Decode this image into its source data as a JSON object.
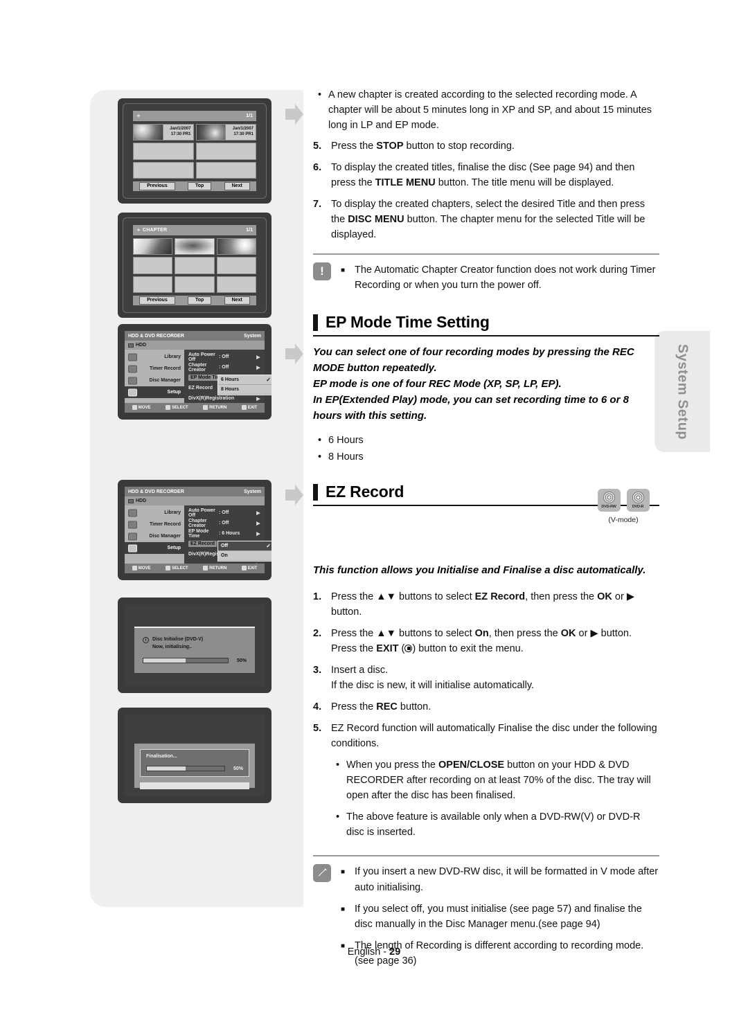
{
  "doc": {
    "footer_lang": "English",
    "footer_sep": " - ",
    "footer_page": "29",
    "side_tab": "System Setup"
  },
  "intro_bullet": "A new chapter is created according to the selected recording mode. A chapter will be about 5 minutes long in XP and SP, and about 15 minutes long in LP and EP mode.",
  "steps_top": [
    {
      "n": "5.",
      "text_html": "Press the <b>STOP</b> button to stop recording."
    },
    {
      "n": "6.",
      "text_html": "To display the created titles, finalise the disc (See page 94) and then press the <b>TITLE MENU</b> button. The title menu will be displayed."
    },
    {
      "n": "7.",
      "text_html": "To display the created chapters, select the desired Title and then press the <b>DISC MENU</b> button. The chapter menu for the selected Title will be displayed."
    }
  ],
  "caution_note": {
    "badge": "!",
    "items": [
      "The Automatic Chapter Creator function does not work during Timer Recording or when you turn the power off."
    ]
  },
  "section_ep": {
    "heading": "EP Mode Time Setting",
    "intro_lines": [
      "You can select one of four recording modes by pressing the REC MODE button repeatedly.",
      "EP mode is one of four REC Mode (XP, SP, LP, EP).",
      "In EP(Extended Play) mode, you can set recording time to 6 or 8 hours with this setting."
    ],
    "options": [
      "6 Hours",
      "8 Hours"
    ]
  },
  "section_ez": {
    "heading": "EZ Record",
    "discs": [
      {
        "label": "DVD-RW"
      },
      {
        "label": "DVD-R"
      }
    ],
    "disc_caption": "(V-mode)",
    "intro": "This function allows you Initialise and Finalise a disc automatically.",
    "steps": [
      {
        "n": "1.",
        "text_html": "Press the ▲▼ buttons to select <b>EZ Record</b>, then press the <b>OK</b> or ▶ button."
      },
      {
        "n": "2.",
        "text_html": "Press the ▲▼ buttons to select <b>On</b>, then press the <b>OK</b> or ▶ button. Press the <b>EXIT</b> (<span class=\"exit-ico\"></span>) button to exit the menu."
      },
      {
        "n": "3.",
        "text_html": "Insert a disc.<br>If the disc is new, it will initialise automatically."
      },
      {
        "n": "4.",
        "text_html": "Press the <b>REC</b> button."
      },
      {
        "n": "5.",
        "text_html": "EZ Record function will automatically Finalise the disc under the following conditions."
      }
    ],
    "sub_bullets": [
      "When you press the <b>OPEN/CLOSE</b> button on your HDD &amp; DVD RECORDER after recording on at least 70% of the disc. The tray will open after the disc has been finalised.",
      "The above feature is available only when a DVD-RW(V) or DVD-R disc is inserted."
    ],
    "note": {
      "badge": "pencil-icon",
      "items": [
        "If you insert a new DVD-RW disc, it will be formatted in V mode after auto initialising.",
        "If you select off, you must initialise (see page 57) and finalise the disc manually in the Disc Manager menu.(see page 94)",
        "The length of Recording is different according to recording mode. (see page 36)"
      ]
    }
  },
  "screens": {
    "title_menu": {
      "header_title": "",
      "page_indicator": "1/1",
      "entries": [
        {
          "date": "Jan/1/2007",
          "time": "17:30 PR1"
        },
        {
          "date": "Jan/1/2007",
          "time": "17:30 PR1"
        }
      ],
      "buttons": [
        "Previous",
        "Top",
        "Next"
      ]
    },
    "chapter_menu": {
      "header_title": "CHAPTER",
      "page_indicator": "1/1",
      "buttons": [
        "Previous",
        "Top",
        "Next"
      ]
    },
    "setup_ep": {
      "title_left": "HDD & DVD RECORDER",
      "title_right": "System",
      "source": "HDD",
      "sidebar": [
        "Library",
        "Timer Record",
        "Disc Manager",
        "Setup"
      ],
      "sidebar_selected": "Setup",
      "rows": [
        {
          "name": "Auto Power Off",
          "value": ": Off",
          "chev": "▶"
        },
        {
          "name": "Chapter Creator",
          "value": ": Off",
          "chev": "▶"
        },
        {
          "name": "EP Mode Time",
          "value": "",
          "chev": ""
        },
        {
          "name": "EZ Record",
          "value": "",
          "chev": ""
        },
        {
          "name": "DivX(R)Registration",
          "value": "",
          "chev": "▶"
        },
        {
          "name": "",
          "value": "",
          "chev": "▶"
        }
      ],
      "highlight_row": "EP Mode Time",
      "popup": {
        "options": [
          {
            "label": "6 Hours",
            "selected": true,
            "check": "✓"
          },
          {
            "label": "8 Hours",
            "selected": false,
            "check": ""
          }
        ]
      },
      "footer": [
        "MOVE",
        "SELECT",
        "RETURN",
        "EXIT"
      ]
    },
    "setup_ez": {
      "title_left": "HDD & DVD RECORDER",
      "title_right": "System",
      "source": "HDD",
      "sidebar": [
        "Library",
        "Timer Record",
        "Disc Manager",
        "Setup"
      ],
      "sidebar_selected": "Setup",
      "rows": [
        {
          "name": "Auto Power Off",
          "value": ": Off",
          "chev": "▶"
        },
        {
          "name": "Chapter Creator",
          "value": ": Off",
          "chev": "▶"
        },
        {
          "name": "EP Mode Time",
          "value": ": 6 Hours",
          "chev": "▶"
        },
        {
          "name": "EZ Record",
          "value": "",
          "chev": ""
        },
        {
          "name": "DivX(R)Registra",
          "value": "",
          "chev": ""
        },
        {
          "name": "",
          "value": "",
          "chev": "▶"
        }
      ],
      "highlight_row": "EZ Record",
      "popup": {
        "options": [
          {
            "label": "Off",
            "selected": true,
            "check": "✓"
          },
          {
            "label": "On",
            "selected": false,
            "check": ""
          }
        ]
      },
      "footer": [
        "MOVE",
        "SELECT",
        "RETURN",
        "EXIT"
      ]
    },
    "dialog_initialise": {
      "line1": "Disc Initialise (DVD-V)",
      "line2": "Now, initialising..",
      "progress_pct": 50,
      "progress_label": "50%"
    },
    "dialog_finalise": {
      "line1": "Finalisation...",
      "progress_pct": 50,
      "progress_label": "50%"
    }
  }
}
